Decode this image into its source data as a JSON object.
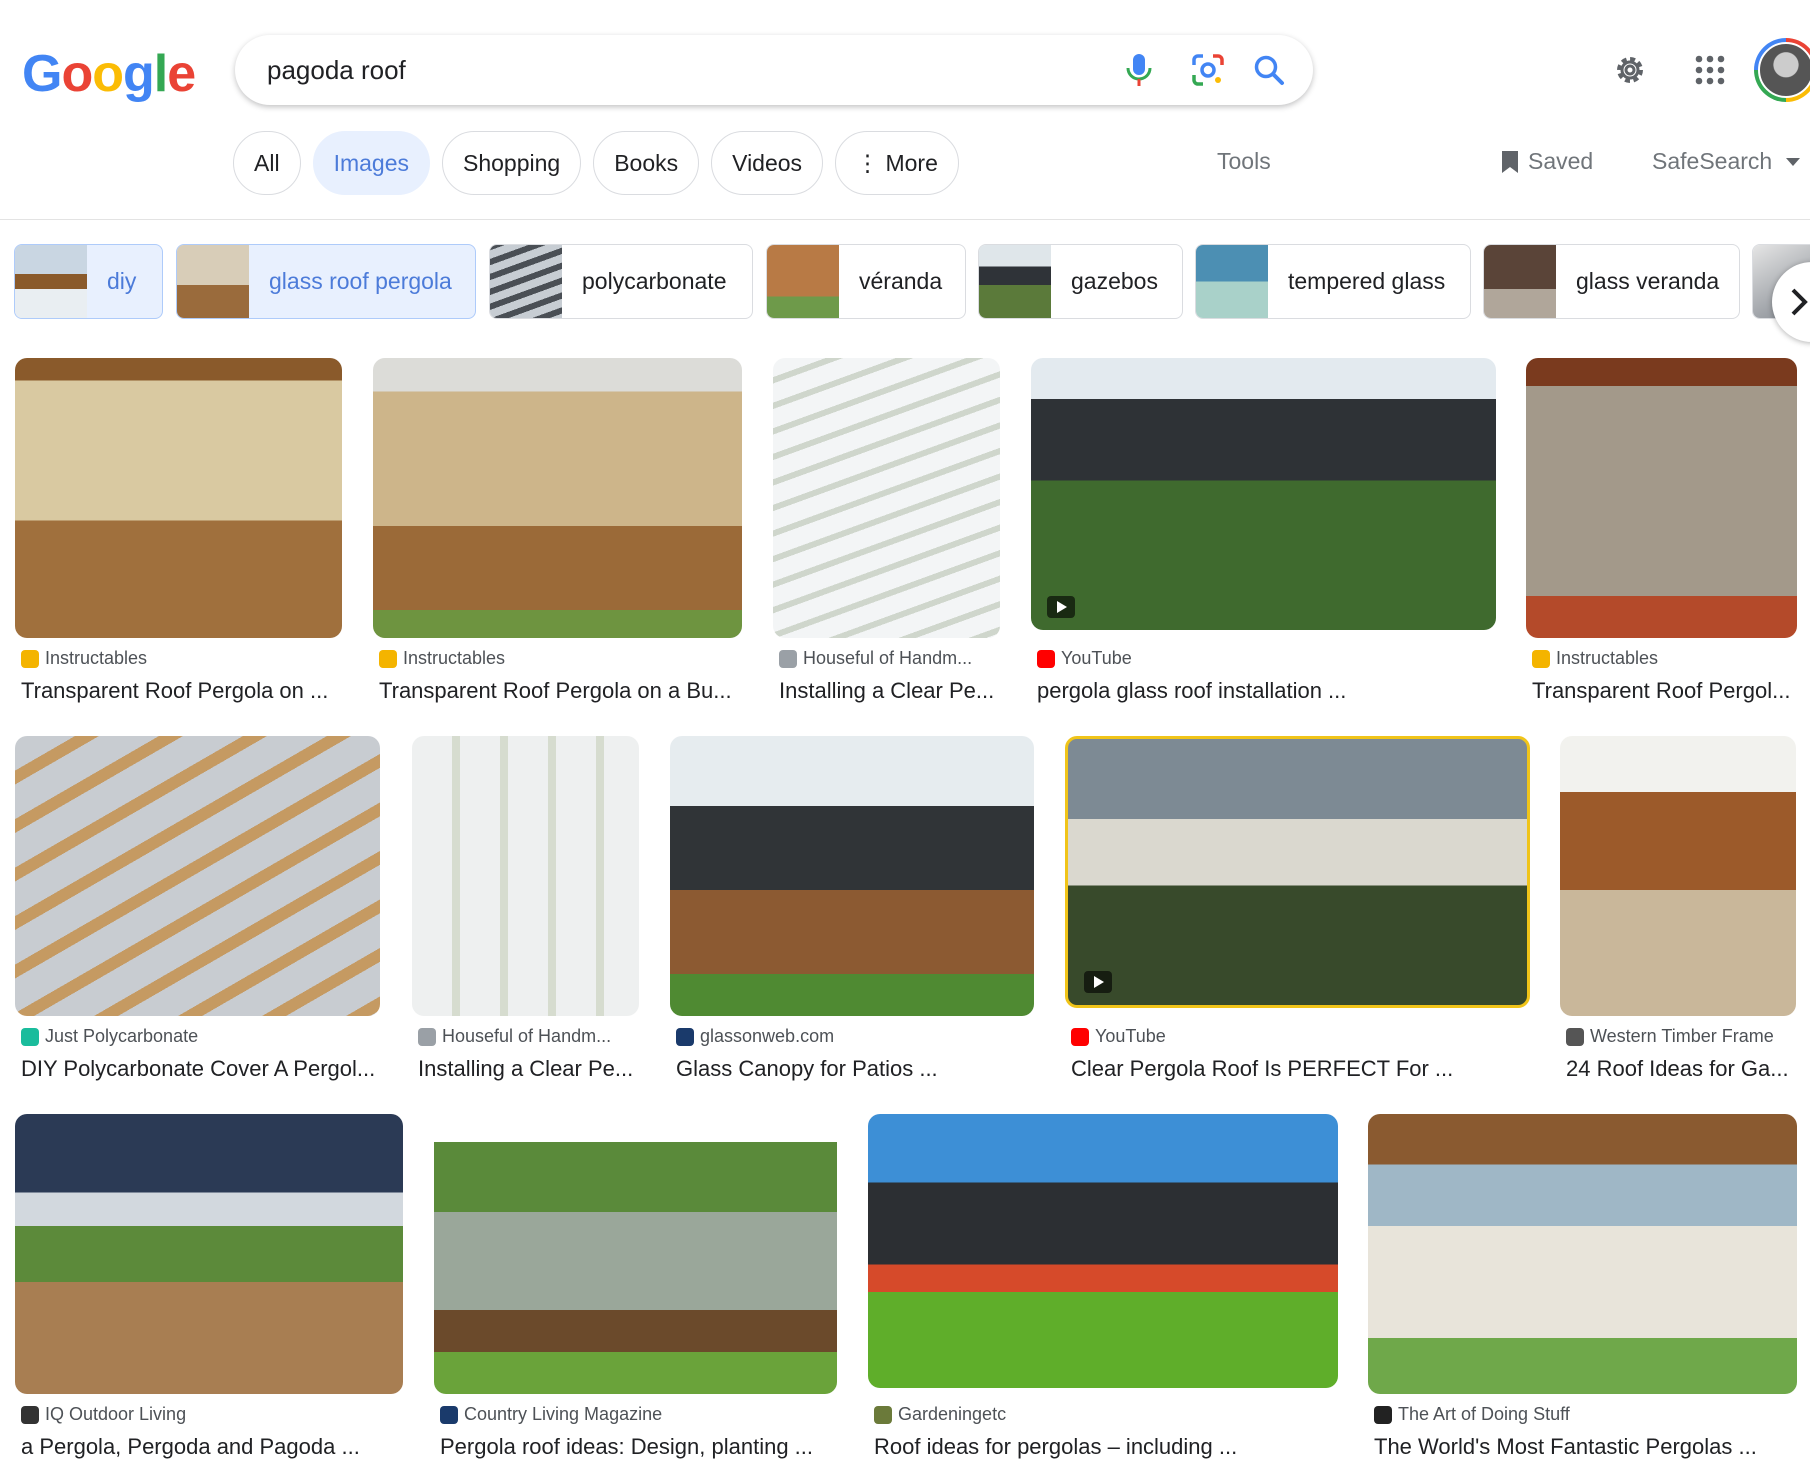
{
  "header": {
    "logo_letters": [
      {
        "ch": "G",
        "color": "#4285f4"
      },
      {
        "ch": "o",
        "color": "#ea4335"
      },
      {
        "ch": "o",
        "color": "#fbbc05"
      },
      {
        "ch": "g",
        "color": "#4285f4"
      },
      {
        "ch": "l",
        "color": "#34a853"
      },
      {
        "ch": "e",
        "color": "#ea4335"
      }
    ],
    "query": "pagoda roof",
    "icons": [
      "microphone-icon",
      "lens-icon",
      "search-icon",
      "gear-icon",
      "apps-icon"
    ]
  },
  "tabs": [
    {
      "label": "All",
      "active": false
    },
    {
      "label": "Images",
      "active": true
    },
    {
      "label": "Shopping",
      "active": false
    },
    {
      "label": "Books",
      "active": false
    },
    {
      "label": "Videos",
      "active": false
    },
    {
      "label": "⋮ More",
      "active": false
    }
  ],
  "toolbar": {
    "tools": "Tools",
    "saved": "Saved",
    "safesearch": "SafeSearch"
  },
  "chips": [
    {
      "label": "diy",
      "selected": true
    },
    {
      "label": "glass roof pergola",
      "selected": true
    },
    {
      "label": "polycarbonate",
      "selected": false
    },
    {
      "label": "véranda",
      "selected": false
    },
    {
      "label": "gazebos",
      "selected": false
    },
    {
      "label": "tempered glass",
      "selected": false
    },
    {
      "label": "glass veranda",
      "selected": false
    }
  ],
  "results": [
    {
      "source": "Instructables",
      "title": "Transparent Roof Pergola on ...",
      "fav": "#f4b400",
      "video": false
    },
    {
      "source": "Instructables",
      "title": "Transparent Roof Pergola on a Bu...",
      "fav": "#f4b400",
      "video": false
    },
    {
      "source": "Houseful of Handm...",
      "title": "Installing a Clear Pe...",
      "fav": "#9aa0a6",
      "video": false
    },
    {
      "source": "YouTube",
      "title": "pergola glass roof installation ...",
      "fav": "#ff0000",
      "video": true
    },
    {
      "source": "Instructables",
      "title": "Transparent Roof Pergol...",
      "fav": "#f4b400",
      "video": false
    },
    {
      "source": "Just Polycarbonate",
      "title": "DIY Polycarbonate Cover A Pergol...",
      "fav": "#1abc9c",
      "video": false
    },
    {
      "source": "Houseful of Handm...",
      "title": "Installing a Clear Pe...",
      "fav": "#9aa0a6",
      "video": false
    },
    {
      "source": "glassonweb.com",
      "title": "Glass Canopy for Patios ...",
      "fav": "#1a3a6b",
      "video": false
    },
    {
      "source": "YouTube",
      "title": "Clear Pergola Roof Is PERFECT For ...",
      "fav": "#ff0000",
      "video": true
    },
    {
      "source": "Western Timber Frame",
      "title": "24 Roof Ideas for Ga...",
      "fav": "#555555",
      "video": false
    },
    {
      "source": "IQ Outdoor Living",
      "title": "a Pergola, Pergoda and Pagoda ...",
      "fav": "#333333",
      "video": false
    },
    {
      "source": "Country Living Magazine",
      "title": "Pergola roof ideas: Design, planting ...",
      "fav": "#1a3a6b",
      "video": false
    },
    {
      "source": "Gardeningetc",
      "title": "Roof ideas for pergolas – including ...",
      "fav": "#6b7a3a",
      "video": false
    },
    {
      "source": "The Art of Doing Stuff",
      "title": "The World's Most Fantastic Pergolas ...",
      "fav": "#222222",
      "video": false
    }
  ]
}
